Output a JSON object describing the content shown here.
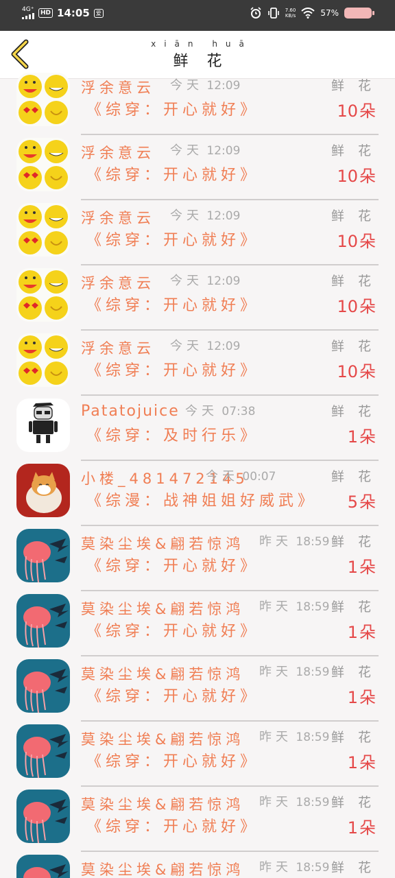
{
  "status_bar": {
    "network": "4G⁺",
    "hd": "HD",
    "time": "14:05",
    "app_badge": "爱",
    "speed_value": "7.60",
    "speed_unit": "KB/s",
    "battery_pct": "57%",
    "icons": [
      "alarm-icon",
      "vibrate-icon",
      "wifi-icon",
      "battery-icon"
    ]
  },
  "header": {
    "title": "鲜 花",
    "title_pinyin": "xiān huā",
    "back_icon": "chevron-left-icon"
  },
  "gift_label": "鲜 花",
  "gift_label_pinyin": "xiān huā",
  "rows": [
    {
      "avatar": "smiley",
      "name": "浮余意云",
      "day": "今天",
      "time": "12:09",
      "book": "《综穿：开心就好》",
      "count": "10",
      "unit": "朵"
    },
    {
      "avatar": "smiley",
      "name": "浮余意云",
      "day": "今天",
      "time": "12:09",
      "book": "《综穿：开心就好》",
      "count": "10",
      "unit": "朵"
    },
    {
      "avatar": "smiley",
      "name": "浮余意云",
      "day": "今天",
      "time": "12:09",
      "book": "《综穿：开心就好》",
      "count": "10",
      "unit": "朵"
    },
    {
      "avatar": "smiley",
      "name": "浮余意云",
      "day": "今天",
      "time": "12:09",
      "book": "《综穿：开心就好》",
      "count": "10",
      "unit": "朵"
    },
    {
      "avatar": "smiley",
      "name": "浮余意云",
      "day": "今天",
      "time": "12:09",
      "book": "《综穿：开心就好》",
      "count": "10",
      "unit": "朵"
    },
    {
      "avatar": "robot",
      "name": "Patatojuice",
      "day": "今天",
      "time": "07:38",
      "book": "《综穿：及时行乐》",
      "count": "1",
      "unit": "朵"
    },
    {
      "avatar": "cat",
      "name": "小楼_481472145",
      "day": "今天",
      "time": "00:07",
      "book": "《综漫：战神姐姐好威武》",
      "count": "5",
      "unit": "朵"
    },
    {
      "avatar": "jellyfish",
      "name": "莫染尘埃&翩若惊鸿",
      "day": "昨天",
      "time": "18:59",
      "book": "《综穿：开心就好》",
      "count": "1",
      "unit": "朵"
    },
    {
      "avatar": "jellyfish",
      "name": "莫染尘埃&翩若惊鸿",
      "day": "昨天",
      "time": "18:59",
      "book": "《综穿：开心就好》",
      "count": "1",
      "unit": "朵"
    },
    {
      "avatar": "jellyfish",
      "name": "莫染尘埃&翩若惊鸿",
      "day": "昨天",
      "time": "18:59",
      "book": "《综穿：开心就好》",
      "count": "1",
      "unit": "朵"
    },
    {
      "avatar": "jellyfish",
      "name": "莫染尘埃&翩若惊鸿",
      "day": "昨天",
      "time": "18:59",
      "book": "《综穿：开心就好》",
      "count": "1",
      "unit": "朵"
    },
    {
      "avatar": "jellyfish",
      "name": "莫染尘埃&翩若惊鸿",
      "day": "昨天",
      "time": "18:59",
      "book": "《综穿：开心就好》",
      "count": "1",
      "unit": "朵"
    },
    {
      "avatar": "jellyfish",
      "name": "莫染尘埃&翩若惊鸿",
      "day": "昨天",
      "time": "18:59",
      "book": "",
      "count": "",
      "unit": ""
    }
  ],
  "colors": {
    "accent": "#f07e54",
    "count_red": "#e54848",
    "muted": "#aaaaaa",
    "status_bar": "#3a3a3a",
    "background": "#f7f5f5"
  }
}
